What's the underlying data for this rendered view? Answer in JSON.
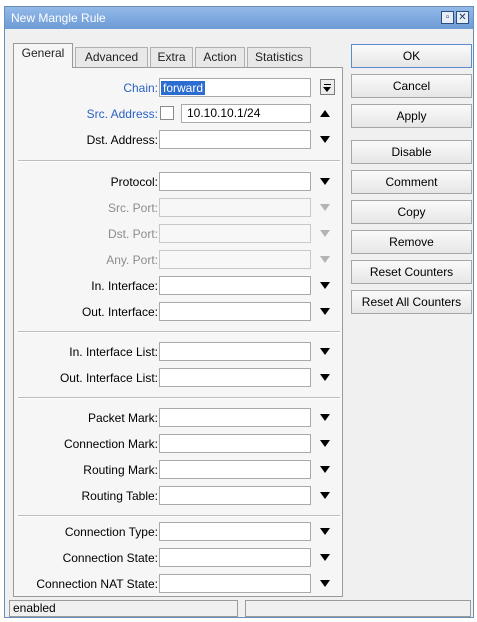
{
  "window": {
    "title": "New Mangle Rule",
    "min_icon": "minimize-icon",
    "close_icon": "close-icon"
  },
  "tabs": [
    {
      "label": "General",
      "active": true
    },
    {
      "label": "Advanced"
    },
    {
      "label": "Extra"
    },
    {
      "label": "Action"
    },
    {
      "label": "Statistics"
    }
  ],
  "fields": {
    "chain": {
      "label": "Chain:",
      "value": "forward"
    },
    "src_address": {
      "label": "Src. Address:",
      "value": "10.10.10.1/24"
    },
    "dst_address": {
      "label": "Dst. Address:"
    },
    "protocol": {
      "label": "Protocol:"
    },
    "src_port": {
      "label": "Src. Port:"
    },
    "dst_port": {
      "label": "Dst. Port:"
    },
    "any_port": {
      "label": "Any. Port:"
    },
    "in_interface": {
      "label": "In. Interface:"
    },
    "out_interface": {
      "label": "Out. Interface:"
    },
    "in_interface_list": {
      "label": "In. Interface List:"
    },
    "out_interface_list": {
      "label": "Out. Interface List:"
    },
    "packet_mark": {
      "label": "Packet Mark:"
    },
    "connection_mark": {
      "label": "Connection Mark:"
    },
    "routing_mark": {
      "label": "Routing Mark:"
    },
    "routing_table": {
      "label": "Routing Table:"
    },
    "connection_type": {
      "label": "Connection Type:"
    },
    "connection_state": {
      "label": "Connection State:"
    },
    "connection_nat_state": {
      "label": "Connection NAT State:"
    }
  },
  "buttons": {
    "ok": "OK",
    "cancel": "Cancel",
    "apply": "Apply",
    "disable": "Disable",
    "comment": "Comment",
    "copy": "Copy",
    "remove": "Remove",
    "reset_counters": "Reset Counters",
    "reset_all_counters": "Reset All Counters"
  },
  "status": {
    "text": "enabled"
  },
  "colors": {
    "title_bar": "#7aa5dc",
    "label_blue": "#2b62c3",
    "selection": "#2a6cd0"
  }
}
